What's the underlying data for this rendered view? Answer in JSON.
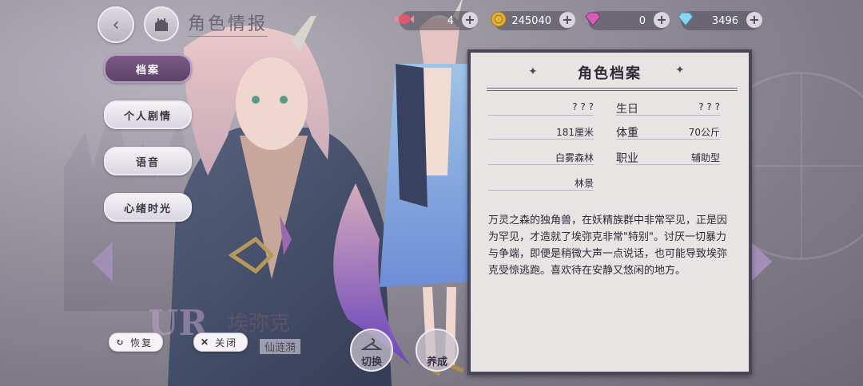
{
  "header": {
    "title": "角色情报",
    "resources": [
      {
        "icon": "candy-icon",
        "value": "4"
      },
      {
        "icon": "coin-icon",
        "value": "245040"
      },
      {
        "icon": "pink-gem-icon",
        "value": "0"
      },
      {
        "icon": "diamond-icon",
        "value": "3496"
      }
    ]
  },
  "menu": [
    {
      "label": "档案",
      "active": true
    },
    {
      "label": "个人剧情",
      "active": false
    },
    {
      "label": "语音",
      "active": false
    },
    {
      "label": "心绪时光",
      "active": false
    }
  ],
  "profile": {
    "title": "角色档案",
    "fields": [
      {
        "key": "",
        "value": "? ? ?"
      },
      {
        "key": "生日",
        "value": "? ? ?"
      },
      {
        "key": "",
        "value": "181厘米"
      },
      {
        "key": "体重",
        "value": "70公斤"
      },
      {
        "key": "",
        "value": "白雾森林"
      },
      {
        "key": "职业",
        "value": "辅助型"
      },
      {
        "key": "",
        "value": "林景"
      }
    ],
    "description": "万灵之森的独角兽，在妖精族群中非常罕见，正是因为罕见，才造就了埃弥克非常\"特别\"。讨厌一切暴力与争端，即便是稍微大声一点说话，也可能导致埃弥克受惊逃跑。喜欢待在安静又悠闲的地方。"
  },
  "bottom": {
    "restore_label": "恢复",
    "close_label": "关闭",
    "rarity": "UR",
    "character_name": "埃弥克",
    "character_subtitle": "仙涟漪",
    "switch_label": "切换",
    "nurture_label": "养成"
  }
}
